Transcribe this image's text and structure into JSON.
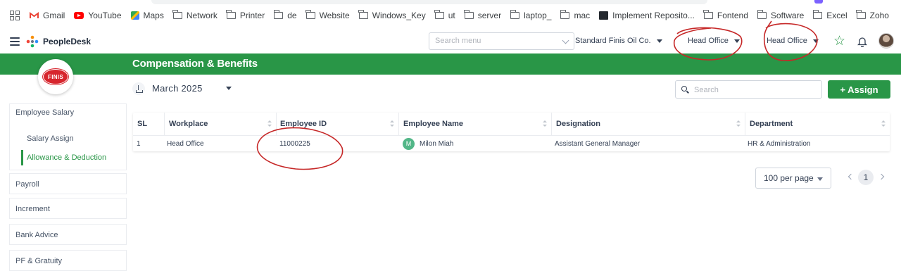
{
  "bookmarks": {
    "items": [
      {
        "label": "Gmail",
        "icon": "gmail-icon"
      },
      {
        "label": "YouTube",
        "icon": "youtube-icon"
      },
      {
        "label": "Maps",
        "icon": "maps-icon"
      },
      {
        "label": "Network",
        "icon": "folder-icon"
      },
      {
        "label": "Printer",
        "icon": "folder-icon"
      },
      {
        "label": "de",
        "icon": "folder-icon"
      },
      {
        "label": "Website",
        "icon": "folder-icon"
      },
      {
        "label": "Windows_Key",
        "icon": "folder-icon"
      },
      {
        "label": "ut",
        "icon": "folder-icon"
      },
      {
        "label": "server",
        "icon": "folder-icon"
      },
      {
        "label": "laptop_",
        "icon": "folder-icon"
      },
      {
        "label": "mac",
        "icon": "folder-icon"
      },
      {
        "label": "Implement Reposito...",
        "icon": "github-icon"
      },
      {
        "label": "Fontend",
        "icon": "folder-icon"
      },
      {
        "label": "Software",
        "icon": "folder-icon"
      },
      {
        "label": "Excel",
        "icon": "folder-icon"
      },
      {
        "label": "Zoho",
        "icon": "folder-icon"
      }
    ]
  },
  "header": {
    "brand": "PeopleDesk",
    "search_placeholder": "Search menu",
    "company": "Standard Finis Oil Co.",
    "office_1": "Head Office",
    "office_2": "Head Office",
    "accent_color": "#299647"
  },
  "page": {
    "title": "Compensation & Benefits",
    "month": "March 2025",
    "search_placeholder": "Search",
    "assign_label": "+ Assign"
  },
  "sidebar": {
    "logo_text": "FINIS",
    "items": [
      {
        "label": "Employee Salary"
      },
      {
        "label": "Salary Assign"
      },
      {
        "label": "Allowance & Deduction",
        "active": true
      },
      {
        "label": "Payroll"
      },
      {
        "label": "Increment"
      },
      {
        "label": "Bank Advice"
      },
      {
        "label": "PF & Gratuity"
      }
    ]
  },
  "table": {
    "headers": [
      "SL",
      "Workplace",
      "Employee ID",
      "Employee Name",
      "Designation",
      "Department"
    ],
    "rows": [
      {
        "sl": "1",
        "workplace": "Head Office",
        "employee_id": "11000225",
        "avatar_letter": "M",
        "employee_name": "Milon Miah",
        "designation": "Assistant General Manager",
        "department": "HR & Administration"
      }
    ]
  },
  "pagination": {
    "per_page": "100 per page",
    "current_page": "1"
  }
}
